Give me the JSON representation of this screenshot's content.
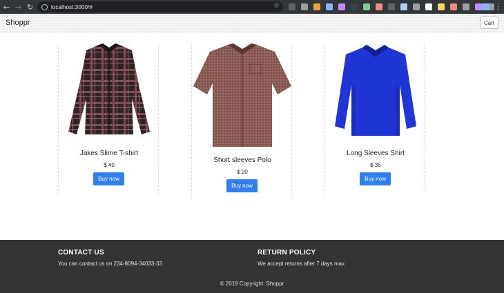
{
  "browser": {
    "url": "localhost:3000/#",
    "extension_colors": [
      "#5f6368",
      "#9aa0a6",
      "#e8a33b",
      "#8ab4f8",
      "#c58af9",
      "#3c4043",
      "#81c995",
      "#f28b82",
      "#5f6368",
      "#aecbfa",
      "#9aa0a6",
      "#ffffff",
      "#fdd663",
      "#f28b82",
      "#9aa0a6",
      "#c58af9",
      "#9aa0a6"
    ]
  },
  "header": {
    "brand": "Shoppr",
    "cart_label": "Cart"
  },
  "products": [
    {
      "name": "Jakes Slime T-shirt",
      "price": "$ 40",
      "buy_label": "Buy now",
      "icon": "plaid-shirt-icon",
      "color": "#3b2a2e"
    },
    {
      "name": "Short sleeves Polo",
      "price": "$ 20",
      "buy_label": "Buy now",
      "icon": "short-sleeve-shirt-icon",
      "color": "#8a5a55"
    },
    {
      "name": "Long Sleeves Shirt",
      "price": "$ 35",
      "buy_label": "Buy now",
      "icon": "long-sleeve-polo-icon",
      "color": "#1f35d6"
    }
  ],
  "footer": {
    "contact_title": "CONTACT US",
    "contact_text": "You can contact us on 234-8094-34033-33",
    "return_title": "RETURN POLICY",
    "return_text": "We accept returns after 7 days max",
    "copyright": "© 2019 Copyright: Shoppr"
  },
  "colors": {
    "accent": "#2f80ed",
    "footer_bg": "#333333"
  }
}
